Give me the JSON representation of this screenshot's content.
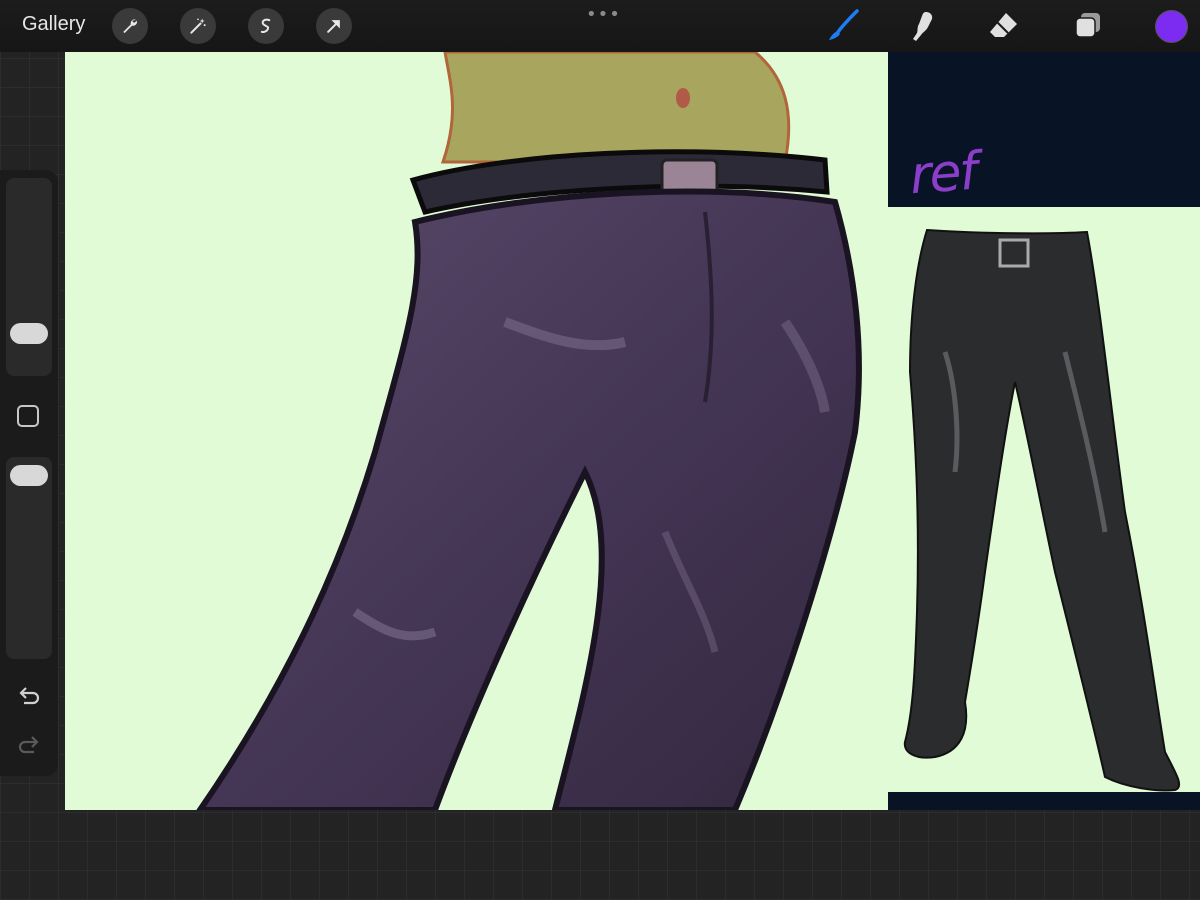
{
  "topbar": {
    "gallery_label": "Gallery",
    "tools": [
      "wrench-icon",
      "magic-wand-icon",
      "selection-icon",
      "transform-arrow-icon"
    ],
    "more_label": "•••",
    "right_tools": [
      "brush-icon",
      "smudge-icon",
      "eraser-icon",
      "layers-icon"
    ],
    "current_color": "#7b2cf0",
    "active_tool_color": "#1e7cf5"
  },
  "sidebar": {
    "items": [
      "brush-size-slider",
      "modify-button",
      "opacity-slider",
      "undo-button",
      "redo-button"
    ]
  },
  "canvas": {
    "background": "#e2fbd7",
    "ref_label": "ref",
    "ref_panel_color": "#081426"
  }
}
